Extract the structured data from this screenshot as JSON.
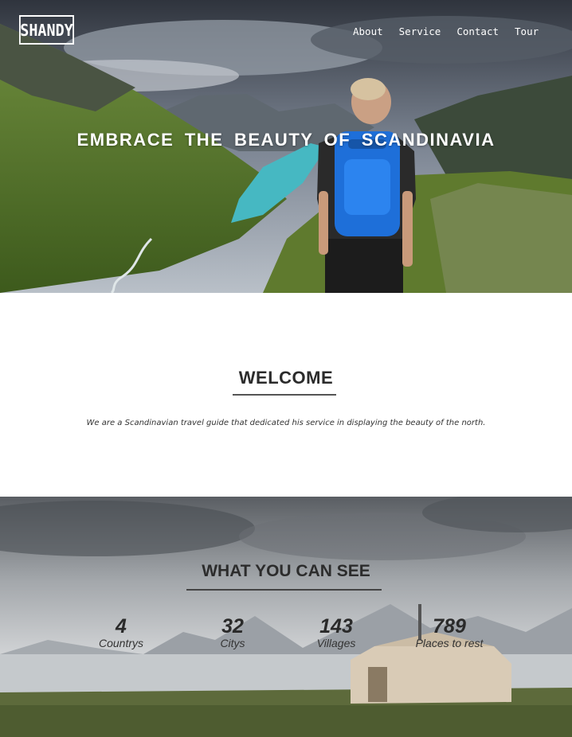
{
  "brand": {
    "logo_text": "SHANDY"
  },
  "nav": {
    "items": [
      "About",
      "Service",
      "Contact",
      "Tour"
    ]
  },
  "hero": {
    "title": "EMBRACE THE BEAUTY OF SCANDINAVIA"
  },
  "welcome": {
    "title": "WELCOME",
    "text": "We are a Scandinavian travel guide that dedicated his service in displaying the beauty of the north."
  },
  "see": {
    "title": "WHAT YOU CAN SEE",
    "stats": [
      {
        "value": "4",
        "label": "Countrys"
      },
      {
        "value": "32",
        "label": "Citys"
      },
      {
        "value": "143",
        "label": "Villages"
      },
      {
        "value": "789",
        "label": "Places to rest"
      }
    ]
  },
  "colors": {
    "accent_backpack": "#1e6fd9",
    "lake": "#3fb8c4",
    "text_dark": "#2b2b2b"
  }
}
